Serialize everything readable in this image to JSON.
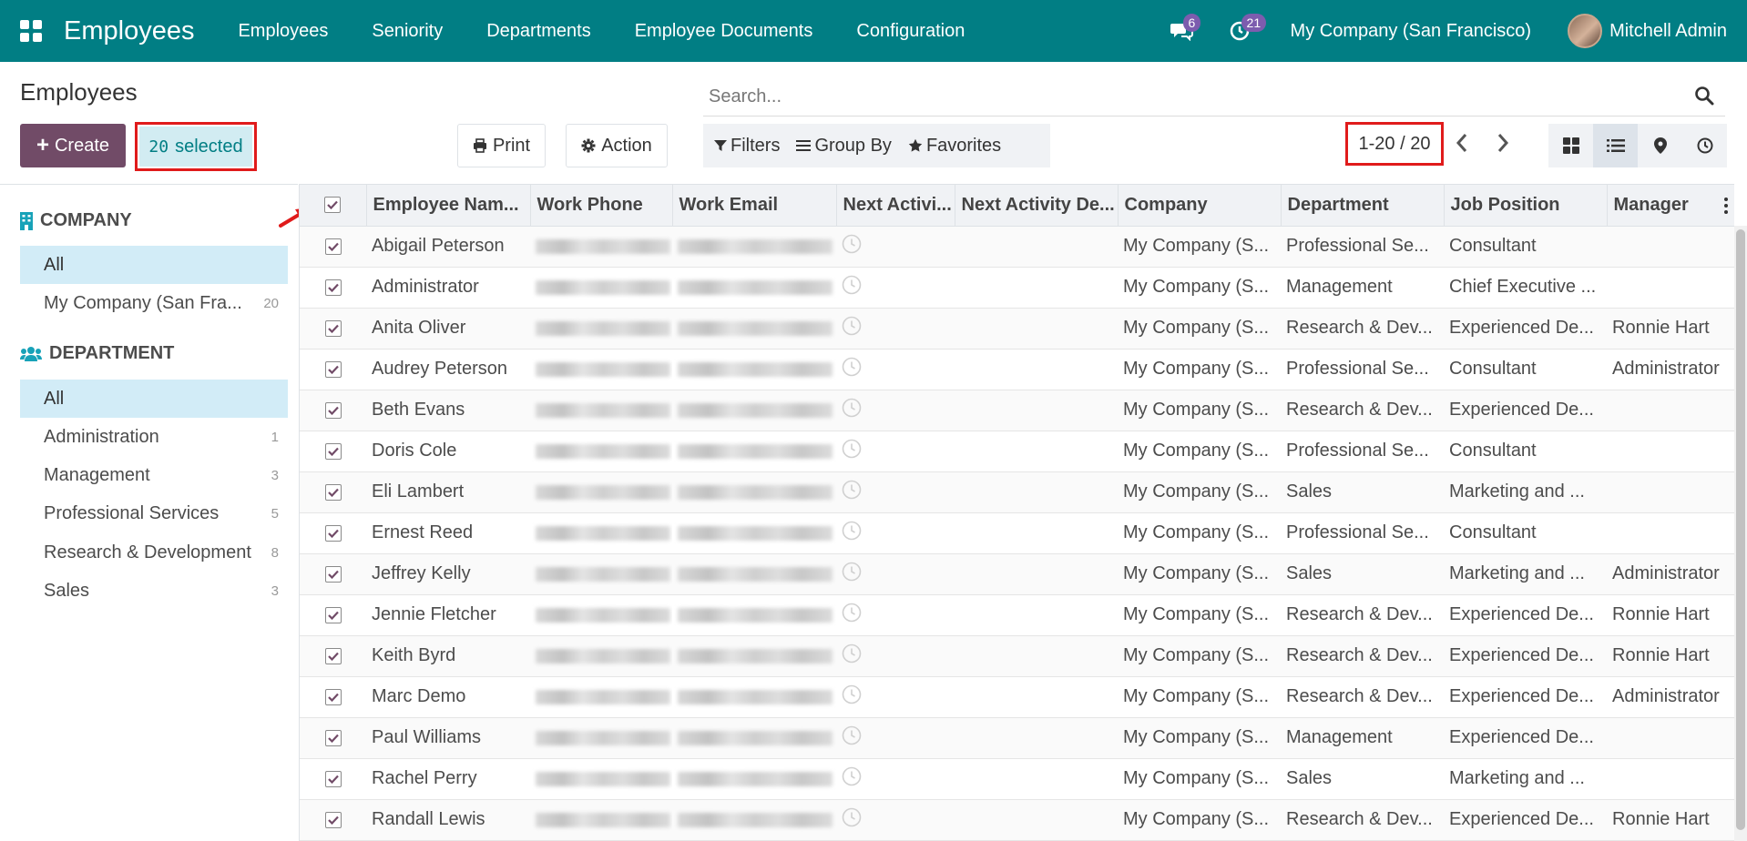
{
  "navbar": {
    "app_title": "Employees",
    "menu": [
      "Employees",
      "Seniority",
      "Departments",
      "Employee Documents",
      "Configuration"
    ],
    "messages_count": "6",
    "activities_count": "21",
    "company": "My Company (San Francisco)",
    "user": "Mitchell Admin"
  },
  "control": {
    "title": "Employees",
    "create_label": "Create",
    "selected_count": "20",
    "selected_label": "selected",
    "print_label": "Print",
    "action_label": "Action",
    "search_placeholder": "Search...",
    "filters_label": "Filters",
    "groupby_label": "Group By",
    "favorites_label": "Favorites",
    "pager": "1-20 / 20"
  },
  "sidebar": {
    "company_heading": "COMPANY",
    "company_items": [
      {
        "label": "All",
        "count": ""
      },
      {
        "label": "My Company (San Fra...",
        "count": "20"
      }
    ],
    "department_heading": "DEPARTMENT",
    "department_items": [
      {
        "label": "All",
        "count": ""
      },
      {
        "label": "Administration",
        "count": "1"
      },
      {
        "label": "Management",
        "count": "3"
      },
      {
        "label": "Professional Services",
        "count": "5"
      },
      {
        "label": "Research & Development",
        "count": "8"
      },
      {
        "label": "Sales",
        "count": "3"
      }
    ]
  },
  "table": {
    "columns": [
      "Employee Nam...",
      "Work Phone",
      "Work Email",
      "Next Activi...",
      "Next Activity De...",
      "Company",
      "Department",
      "Job Position",
      "Manager"
    ],
    "rows": [
      {
        "name": "Abigail Peterson",
        "company": "My Company (S...",
        "department": "Professional Se...",
        "job": "Consultant",
        "manager": ""
      },
      {
        "name": "Administrator",
        "company": "My Company (S...",
        "department": "Management",
        "job": "Chief Executive ...",
        "manager": ""
      },
      {
        "name": "Anita Oliver",
        "company": "My Company (S...",
        "department": "Research & Dev...",
        "job": "Experienced De...",
        "manager": "Ronnie Hart"
      },
      {
        "name": "Audrey Peterson",
        "company": "My Company (S...",
        "department": "Professional Se...",
        "job": "Consultant",
        "manager": "Administrator"
      },
      {
        "name": "Beth Evans",
        "company": "My Company (S...",
        "department": "Research & Dev...",
        "job": "Experienced De...",
        "manager": ""
      },
      {
        "name": "Doris Cole",
        "company": "My Company (S...",
        "department": "Professional Se...",
        "job": "Consultant",
        "manager": ""
      },
      {
        "name": "Eli Lambert",
        "company": "My Company (S...",
        "department": "Sales",
        "job": "Marketing and ...",
        "manager": ""
      },
      {
        "name": "Ernest Reed",
        "company": "My Company (S...",
        "department": "Professional Se...",
        "job": "Consultant",
        "manager": ""
      },
      {
        "name": "Jeffrey Kelly",
        "company": "My Company (S...",
        "department": "Sales",
        "job": "Marketing and ...",
        "manager": "Administrator"
      },
      {
        "name": "Jennie Fletcher",
        "company": "My Company (S...",
        "department": "Research & Dev...",
        "job": "Experienced De...",
        "manager": "Ronnie Hart"
      },
      {
        "name": "Keith Byrd",
        "company": "My Company (S...",
        "department": "Research & Dev...",
        "job": "Experienced De...",
        "manager": "Ronnie Hart"
      },
      {
        "name": "Marc Demo",
        "company": "My Company (S...",
        "department": "Research & Dev...",
        "job": "Experienced De...",
        "manager": "Administrator"
      },
      {
        "name": "Paul Williams",
        "company": "My Company (S...",
        "department": "Management",
        "job": "Experienced De...",
        "manager": ""
      },
      {
        "name": "Rachel Perry",
        "company": "My Company (S...",
        "department": "Sales",
        "job": "Marketing and ...",
        "manager": ""
      },
      {
        "name": "Randall Lewis",
        "company": "My Company (S...",
        "department": "Research & Dev...",
        "job": "Experienced De...",
        "manager": "Ronnie Hart"
      }
    ]
  },
  "colors": {
    "navbar": "#017e84",
    "primary_button": "#714b67",
    "highlight_outline": "#e01b1b",
    "checkbox": "#714b67"
  }
}
